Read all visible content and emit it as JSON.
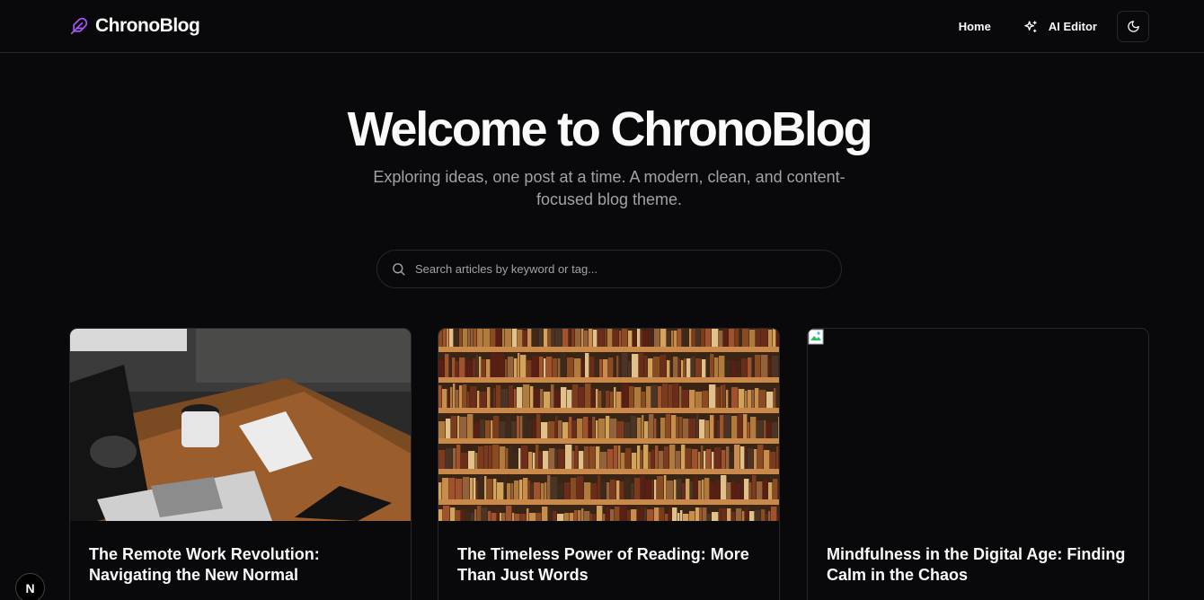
{
  "header": {
    "brand": "ChronoBlog",
    "nav": {
      "home": "Home",
      "ai_editor": "AI Editor"
    }
  },
  "hero": {
    "title": "Welcome to ChronoBlog",
    "subtitle": "Exploring ideas, one post at a time. A modern, clean, and content-focused blog theme."
  },
  "search": {
    "placeholder": "Search articles by keyword or tag..."
  },
  "posts": [
    {
      "title": "The Remote Work Revolution: Navigating the New Normal"
    },
    {
      "title": "The Timeless Power of Reading: More Than Just Words"
    },
    {
      "title": "Mindfulness in the Digital Age: Finding Calm in the Chaos"
    }
  ],
  "dev_badge": "N",
  "colors": {
    "background": "#09090b",
    "border": "#27272a",
    "text": "#fafafa",
    "muted": "#a1a1aa",
    "accent": "#a855f7"
  },
  "icons": {
    "brand": "feather-icon",
    "ai_editor": "sparkles-icon",
    "theme_toggle": "moon-icon",
    "search": "search-icon"
  }
}
